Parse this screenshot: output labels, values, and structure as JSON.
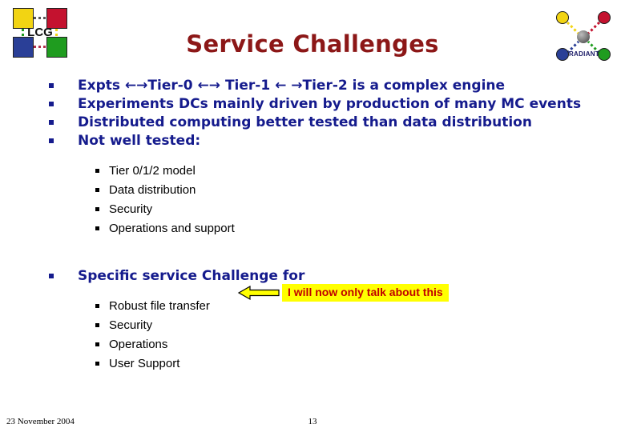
{
  "slide": {
    "title": "Service Challenges",
    "title_color": "#8C1717",
    "background_color": "#FFFFFF",
    "body_color": "#151B8D",
    "sub_color": "#000000"
  },
  "logos": {
    "lcg": {
      "label": "LCG",
      "square_colors": [
        "#F2D413",
        "#C4122F",
        "#2A3F97",
        "#1F9C1F"
      ]
    },
    "radiant": {
      "label": "RADIANT",
      "dot_colors": [
        "#F2D413",
        "#C4122F",
        "#2A3F97",
        "#1F9C1F"
      ]
    }
  },
  "bullets": {
    "level1": [
      "Expts ←→Tier-0 ←→ Tier-1 ← →Tier-2 is a complex engine",
      "Experiments DCs mainly driven by production of many MC events",
      "Distributed computing better tested than data distribution",
      "Not well tested:"
    ],
    "level2_group1": [
      "Tier 0/1/2 model",
      "Data distribution",
      "Security",
      "Operations and support"
    ],
    "level1_second": "Specific service Challenge for",
    "level2_group2": [
      "Robust file transfer",
      "Security",
      "Operations",
      "User Support"
    ]
  },
  "callout": {
    "text": "I will now only talk about this",
    "background_color": "#FFFF00",
    "text_color": "#C00000",
    "arrow_fill": "#FFFF00",
    "arrow_stroke": "#000000",
    "arrow_direction": "left"
  },
  "footer": {
    "date": "23 November 2004",
    "page_number": "13"
  }
}
